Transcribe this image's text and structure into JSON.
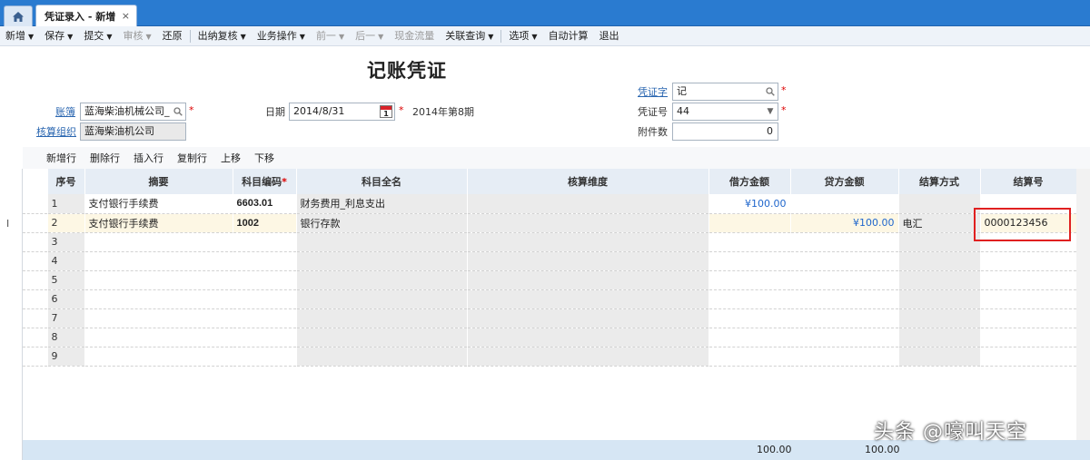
{
  "tabs": {
    "home_icon": "home-icon",
    "active_tab": "凭证录入 - 新增",
    "close": "×"
  },
  "toolbar": [
    {
      "label": "新增",
      "caret": true,
      "disabled": false
    },
    {
      "label": "保存",
      "caret": true,
      "disabled": false
    },
    {
      "label": "提交",
      "caret": true,
      "disabled": false
    },
    {
      "label": "审核",
      "caret": true,
      "disabled": true
    },
    {
      "label": "还原",
      "caret": false,
      "disabled": false
    },
    {
      "label": "出纳复核",
      "caret": true,
      "disabled": false
    },
    {
      "label": "业务操作",
      "caret": true,
      "disabled": false
    },
    {
      "label": "前一",
      "caret": true,
      "disabled": true
    },
    {
      "label": "后一",
      "caret": true,
      "disabled": true
    },
    {
      "label": "现金流量",
      "caret": false,
      "disabled": true
    },
    {
      "label": "关联查询",
      "caret": true,
      "disabled": false
    },
    {
      "label": "选项",
      "caret": true,
      "disabled": false
    },
    {
      "label": "自动计算",
      "caret": false,
      "disabled": false
    },
    {
      "label": "退出",
      "caret": false,
      "disabled": false
    }
  ],
  "header": {
    "title": "记账凭证",
    "ledger_label": "账簿",
    "ledger_value": "蓝海柴油机械公司_",
    "org_label": "核算组织",
    "org_value": "蓝海柴油机公司",
    "date_label": "日期",
    "date_value": "2014/8/31",
    "calendar_day": "1",
    "period_text": "2014年第8期",
    "voucher_word_label": "凭证字",
    "voucher_word_value": "记",
    "voucher_no_label": "凭证号",
    "voucher_no_value": "44",
    "attach_label": "附件数",
    "attach_value": "0",
    "required_mark": "*"
  },
  "grid_tools": [
    "新增行",
    "删除行",
    "插入行",
    "复制行",
    "上移",
    "下移"
  ],
  "columns": [
    "序号",
    "摘要",
    "科目编码",
    "科目全名",
    "核算维度",
    "借方金额",
    "贷方金额",
    "结算方式",
    "结算号"
  ],
  "rows": [
    {
      "no": "1",
      "summary": "支付银行手续费",
      "code": "6603.01",
      "account": "财务费用_利息支出",
      "dimension": "",
      "debit": "¥100.00",
      "credit": "",
      "method": "",
      "ref": ""
    },
    {
      "no": "2",
      "summary": "支付银行手续费",
      "code": "1002",
      "account": "银行存款",
      "dimension": "",
      "debit": "",
      "credit": "¥100.00",
      "method": "电汇",
      "ref": "0000123456"
    },
    {
      "no": "3",
      "summary": "",
      "code": "",
      "account": "",
      "dimension": "",
      "debit": "",
      "credit": "",
      "method": "",
      "ref": ""
    },
    {
      "no": "4",
      "summary": "",
      "code": "",
      "account": "",
      "dimension": "",
      "debit": "",
      "credit": "",
      "method": "",
      "ref": ""
    },
    {
      "no": "5",
      "summary": "",
      "code": "",
      "account": "",
      "dimension": "",
      "debit": "",
      "credit": "",
      "method": "",
      "ref": ""
    },
    {
      "no": "6",
      "summary": "",
      "code": "",
      "account": "",
      "dimension": "",
      "debit": "",
      "credit": "",
      "method": "",
      "ref": ""
    },
    {
      "no": "7",
      "summary": "",
      "code": "",
      "account": "",
      "dimension": "",
      "debit": "",
      "credit": "",
      "method": "",
      "ref": ""
    },
    {
      "no": "8",
      "summary": "",
      "code": "",
      "account": "",
      "dimension": "",
      "debit": "",
      "credit": "",
      "method": "",
      "ref": ""
    },
    {
      "no": "9",
      "summary": "",
      "code": "",
      "account": "",
      "dimension": "",
      "debit": "",
      "credit": "",
      "method": "",
      "ref": ""
    }
  ],
  "row_cursor": "I",
  "totals": {
    "debit": "100.00",
    "credit": "100.00"
  },
  "watermark": "头条 @嚎叫天空",
  "colors": {
    "tabbar": "#2a7bd0",
    "amount": "#1f66cc",
    "highlight": "#e02020",
    "required": "#dd0000"
  }
}
